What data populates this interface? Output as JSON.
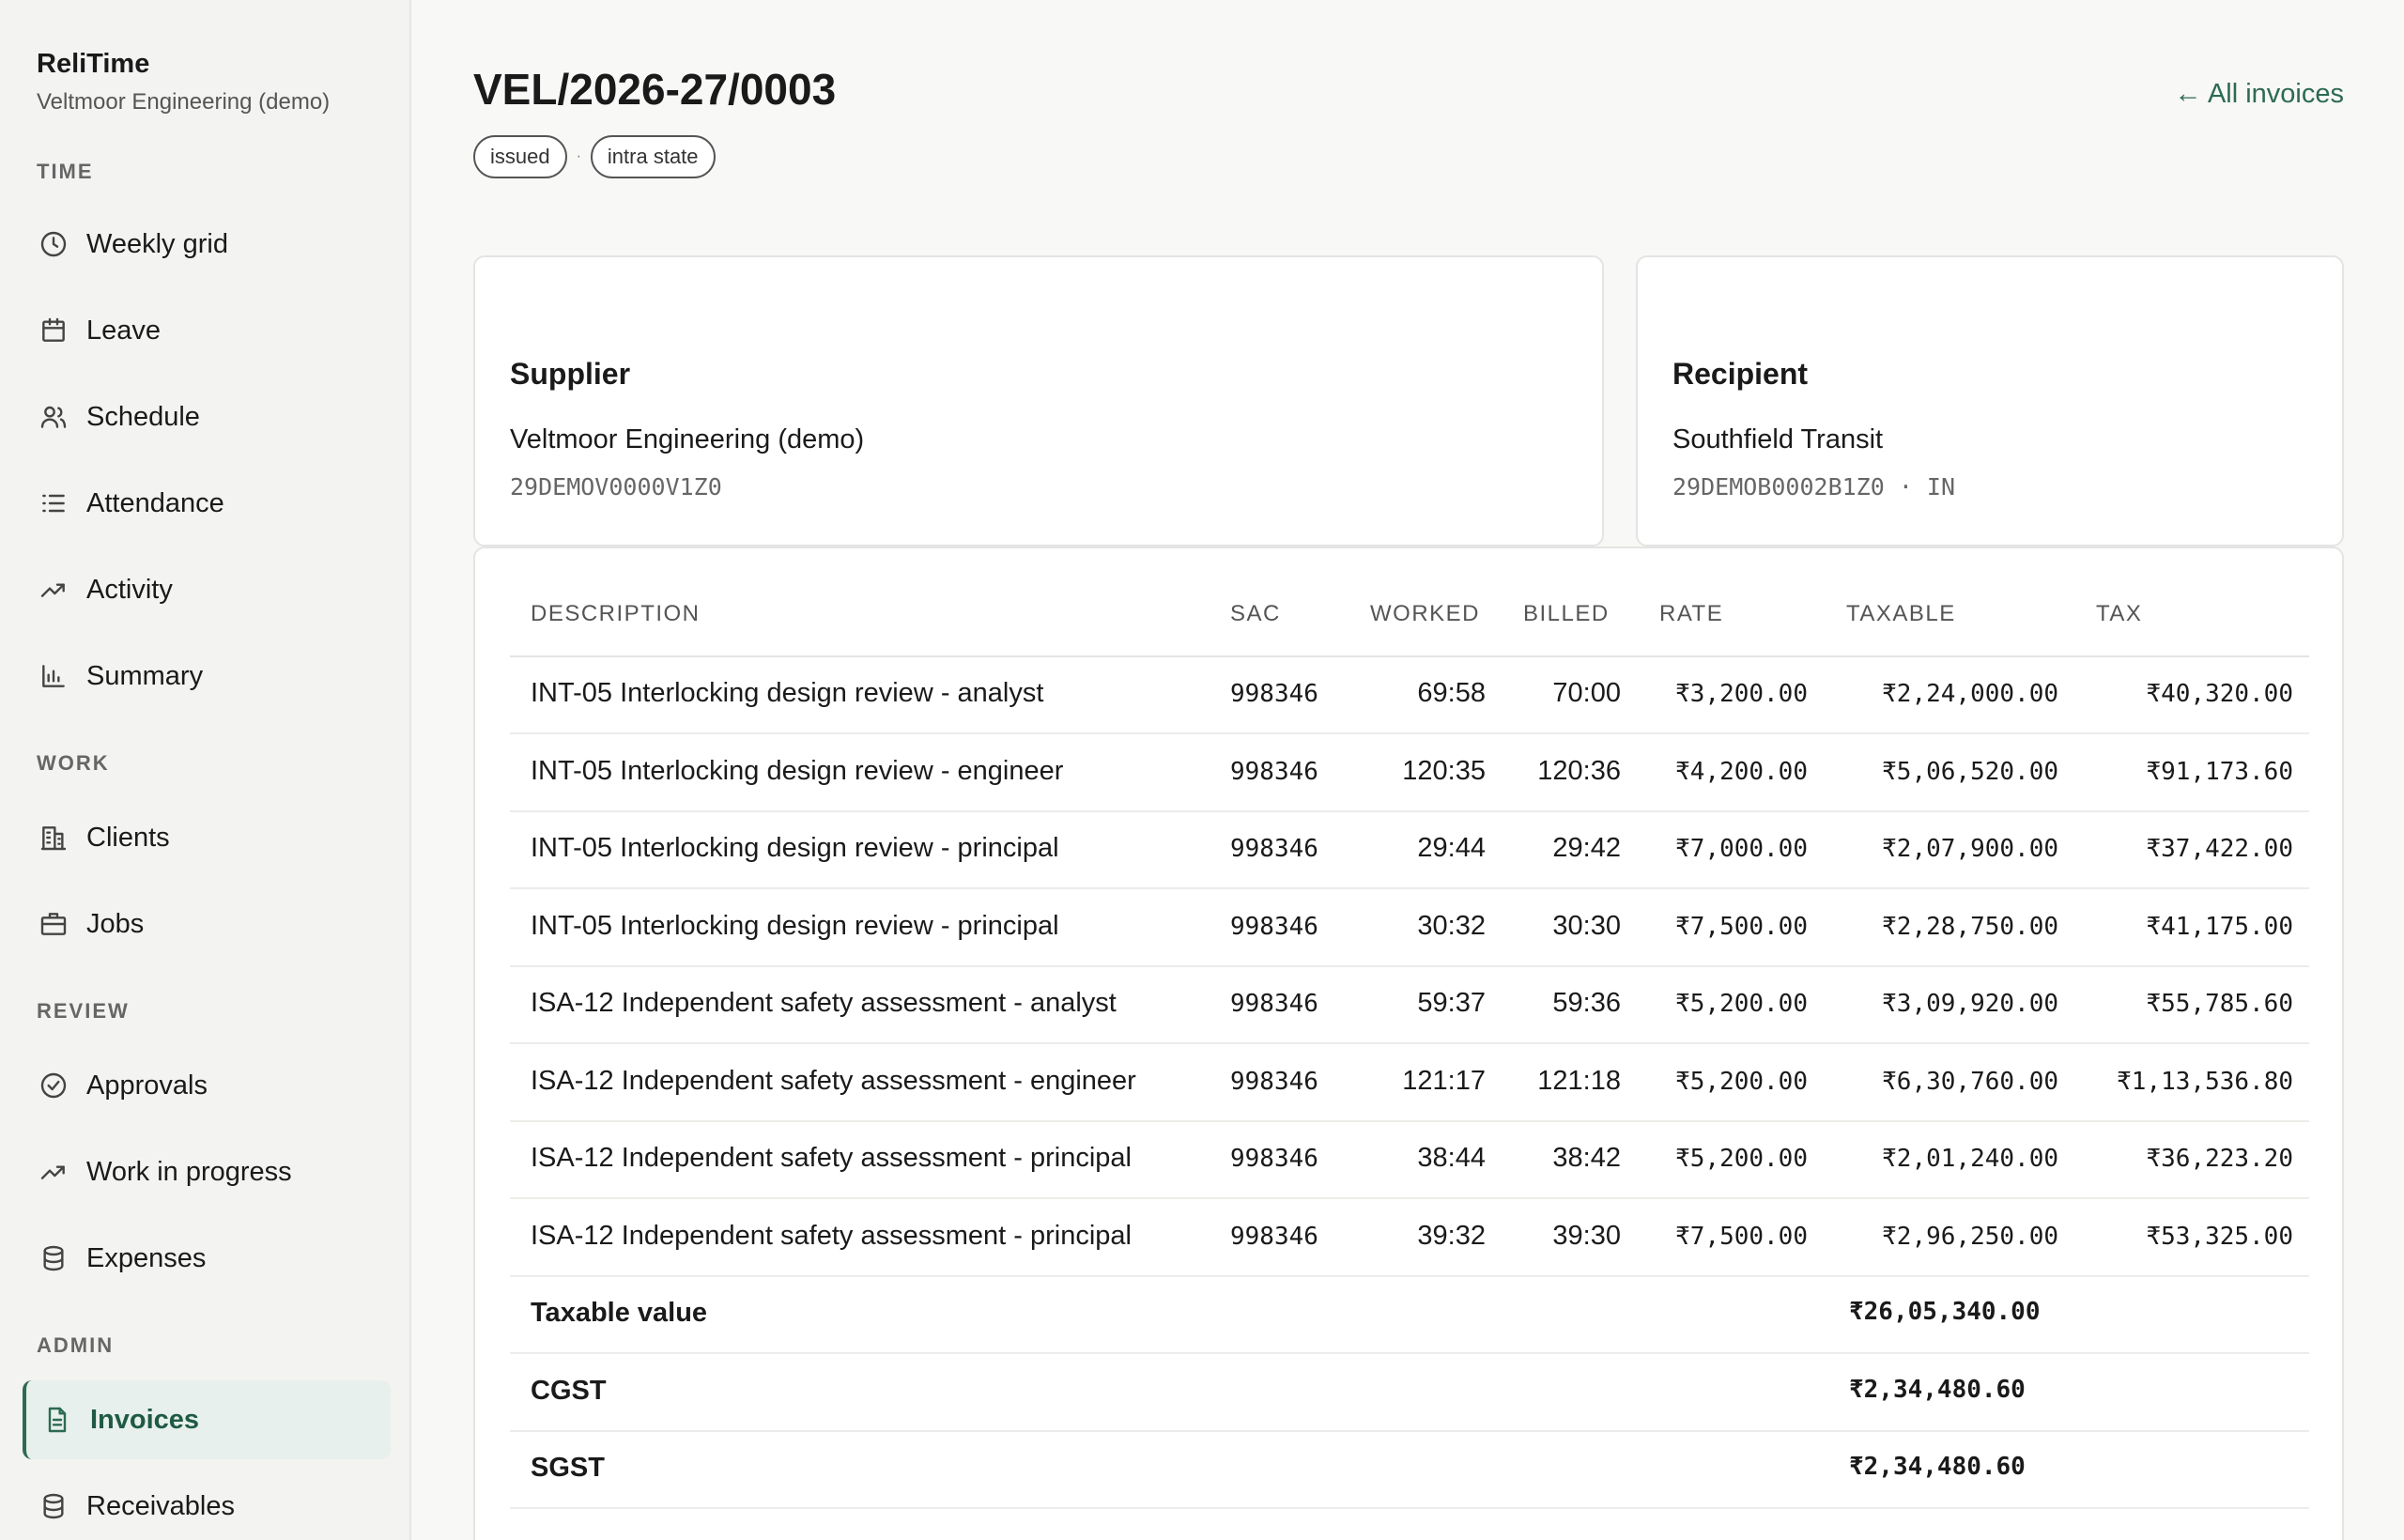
{
  "brand": {
    "name": "ReliTime",
    "org": "Veltmoor Engineering (demo)"
  },
  "sidebar": {
    "sections": [
      {
        "label": "TIME"
      },
      {
        "label": "WORK"
      },
      {
        "label": "REVIEW"
      },
      {
        "label": "ADMIN"
      }
    ],
    "items": [
      {
        "label": "Weekly grid",
        "icon": "clock-icon"
      },
      {
        "label": "Leave",
        "icon": "calendar-icon"
      },
      {
        "label": "Schedule",
        "icon": "users-icon"
      },
      {
        "label": "Attendance",
        "icon": "list-icon"
      },
      {
        "label": "Activity",
        "icon": "trending-up-icon"
      },
      {
        "label": "Summary",
        "icon": "bar-chart-icon"
      },
      {
        "label": "Clients",
        "icon": "building-icon"
      },
      {
        "label": "Jobs",
        "icon": "briefcase-icon"
      },
      {
        "label": "Approvals",
        "icon": "check-circle-icon"
      },
      {
        "label": "Work in progress",
        "icon": "trending-up-icon"
      },
      {
        "label": "Expenses",
        "icon": "database-icon"
      },
      {
        "label": "Invoices",
        "icon": "document-icon",
        "active": true
      },
      {
        "label": "Receivables",
        "icon": "database-icon"
      }
    ]
  },
  "invoice": {
    "number": "VEL/2026-27/0003",
    "back_label": "← All invoices",
    "status": "issued",
    "supply_type": "intra state",
    "separator": "·"
  },
  "supplier": {
    "heading": "Supplier",
    "name": "Veltmoor Engineering (demo)",
    "gstin": "29DEMOV0000V1Z0"
  },
  "recipient": {
    "heading": "Recipient",
    "name": "Southfield Transit",
    "gstin": "29DEMOB0002B1Z0 · IN"
  },
  "table": {
    "headers": {
      "description": "DESCRIPTION",
      "sac": "SAC",
      "worked": "WORKED",
      "billed": "BILLED",
      "rate": "RATE",
      "taxable": "TAXABLE",
      "tax": "TAX"
    },
    "rows": [
      {
        "description": "INT-05 Interlocking design review - analyst",
        "sac": "998346",
        "worked": "69:58",
        "billed": "70:00",
        "rate": "₹3,200.00",
        "taxable": "₹2,24,000.00",
        "tax": "₹40,320.00"
      },
      {
        "description": "INT-05 Interlocking design review - engineer",
        "sac": "998346",
        "worked": "120:35",
        "billed": "120:36",
        "rate": "₹4,200.00",
        "taxable": "₹5,06,520.00",
        "tax": "₹91,173.60"
      },
      {
        "description": "INT-05 Interlocking design review - principal",
        "sac": "998346",
        "worked": "29:44",
        "billed": "29:42",
        "rate": "₹7,000.00",
        "taxable": "₹2,07,900.00",
        "tax": "₹37,422.00"
      },
      {
        "description": "INT-05 Interlocking design review - principal",
        "sac": "998346",
        "worked": "30:32",
        "billed": "30:30",
        "rate": "₹7,500.00",
        "taxable": "₹2,28,750.00",
        "tax": "₹41,175.00"
      },
      {
        "description": "ISA-12 Independent safety assessment - analyst",
        "sac": "998346",
        "worked": "59:37",
        "billed": "59:36",
        "rate": "₹5,200.00",
        "taxable": "₹3,09,920.00",
        "tax": "₹55,785.60"
      },
      {
        "description": "ISA-12 Independent safety assessment - engineer",
        "sac": "998346",
        "worked": "121:17",
        "billed": "121:18",
        "rate": "₹5,200.00",
        "taxable": "₹6,30,760.00",
        "tax": "₹1,13,536.80"
      },
      {
        "description": "ISA-12 Independent safety assessment - principal",
        "sac": "998346",
        "worked": "38:44",
        "billed": "38:42",
        "rate": "₹5,200.00",
        "taxable": "₹2,01,240.00",
        "tax": "₹36,223.20"
      },
      {
        "description": "ISA-12 Independent safety assessment - principal",
        "sac": "998346",
        "worked": "39:32",
        "billed": "39:30",
        "rate": "₹7,500.00",
        "taxable": "₹2,96,250.00",
        "tax": "₹53,325.00"
      }
    ],
    "totals": [
      {
        "label": "Taxable value",
        "value": "₹26,05,340.00"
      },
      {
        "label": "CGST",
        "value": "₹2,34,480.60"
      },
      {
        "label": "SGST",
        "value": "₹2,34,480.60"
      }
    ]
  }
}
